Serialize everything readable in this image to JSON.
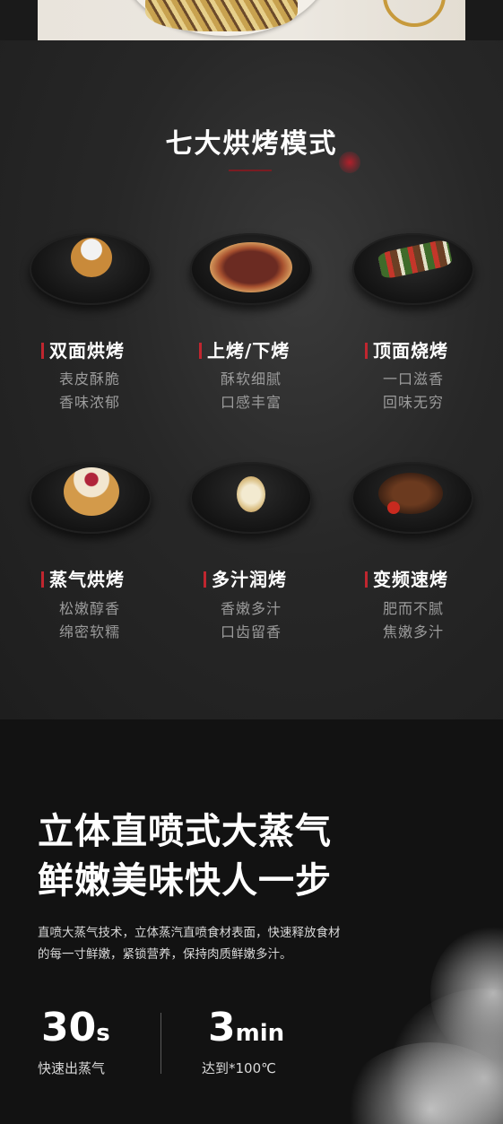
{
  "modes_section": {
    "title": "七大烘烤模式",
    "items": [
      {
        "name": "双面烘烤",
        "desc1": "表皮酥脆",
        "desc2": "香味浓郁"
      },
      {
        "name": "上烤/下烤",
        "desc1": "酥软细腻",
        "desc2": "口感丰富"
      },
      {
        "name": "顶面烧烤",
        "desc1": "一口滋香",
        "desc2": "回味无穷"
      },
      {
        "name": "蒸气烘烤",
        "desc1": "松嫩醇香",
        "desc2": "绵密软糯"
      },
      {
        "name": "多汁润烤",
        "desc1": "香嫩多汁",
        "desc2": "口齿留香"
      },
      {
        "name": "变频速烤",
        "desc1": "肥而不腻",
        "desc2": "焦嫩多汁"
      }
    ]
  },
  "steam_section": {
    "title_line1": "立体直喷式大蒸气",
    "title_line2": "鲜嫩美味快人一步",
    "desc_line1": "直喷大蒸气技术，立体蒸汽直喷食材表面，快速释放食材",
    "desc_line2": "的每一寸鲜嫩，紧锁营养，保持肉质鲜嫩多汁。",
    "stats": [
      {
        "number": "30",
        "unit": "s",
        "label": "快速出蒸气"
      },
      {
        "number": "3",
        "unit": "min",
        "label": "达到*100℃"
      }
    ]
  },
  "colors": {
    "accent": "#c0262f",
    "background": "#1a1a1a"
  }
}
